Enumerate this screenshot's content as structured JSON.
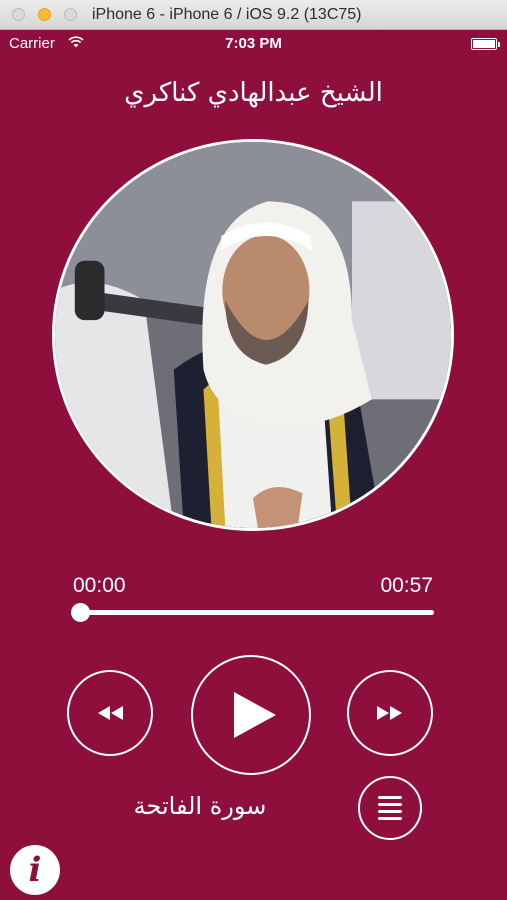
{
  "window": {
    "title": "iPhone 6 - iPhone 6 / iOS 9.2 (13C75)"
  },
  "status_bar": {
    "carrier": "Carrier",
    "time": "7:03 PM",
    "wifi_icon": "wifi-icon",
    "battery_icon": "battery-icon"
  },
  "player": {
    "reciter_name": "الشيخ عبدالهادي كناكري",
    "current_time": "00:00",
    "total_time": "00:57",
    "progress": 0,
    "surah_name": "سورة الفاتحة",
    "controls": {
      "rewind_icon": "rewind-icon",
      "play_icon": "play-icon",
      "forward_icon": "fast-forward-icon",
      "playlist_icon": "list-icon",
      "info_icon": "info-icon",
      "info_glyph": "i"
    }
  },
  "colors": {
    "background": "#8e0f3c",
    "foreground": "#ffffff"
  }
}
